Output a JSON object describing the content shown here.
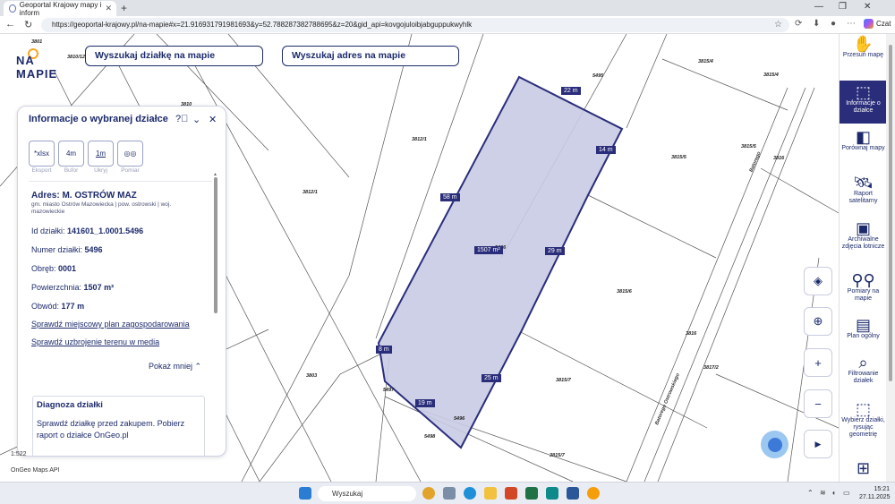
{
  "browser": {
    "tab_title": "Geoportal Krajowy mapy i inform",
    "url": "https://geoportal-krajowy.pl/na-mapie#x=21.916931791981693&y=52.788287382788695&z=20&gid_api=kovgojuloibjabguppukwyhlk",
    "copilot_label": "Czat"
  },
  "header": {
    "logo_text": "NA MAPIE",
    "search_parcel": "Wyszukaj działkę na mapie",
    "search_address": "Wyszukaj adres na mapie"
  },
  "panel": {
    "title": "Informacje o wybranej działce",
    "actions": [
      {
        "icon_text": "*xlsx",
        "label": "Eksport"
      },
      {
        "icon_text": "4m",
        "label": "Bufor"
      },
      {
        "icon_text": "1m",
        "label": "Ukryj"
      },
      {
        "icon_text": "◎◎",
        "label": "Pomiar"
      }
    ],
    "address": "Adres: M. OSTRÓW MAZ",
    "address_sub": "gm. miasto Ostrów Mazowiecka | pow. ostrowski | woj. mazowieckie",
    "rows": [
      {
        "label": "Id działki:",
        "value": "141601_1.0001.5496"
      },
      {
        "label": "Numer działki:",
        "value": "5496"
      },
      {
        "label": "Obręb:",
        "value": "0001"
      },
      {
        "label": "Powierzchnia:",
        "value": "1507 m²"
      },
      {
        "label": "Obwód:",
        "value": "177 m"
      }
    ],
    "link_plan": "Sprawdź miejscowy plan zagospodarowania",
    "link_media": "Sprawdź uzbrojenie terenu w media",
    "show_less": "Pokaż mniej",
    "diag_title": "Diagnoza działki",
    "diag_body": "Sprawdź działkę przed zakupem. Pobierz raport o działce OnGeo.pl"
  },
  "map": {
    "parcel_labels": [
      "3801",
      "3810/12",
      "3812/1",
      "3812/1",
      "5495",
      "3815/4",
      "3815/4",
      "3815/5",
      "3815/5",
      "3816",
      "3815/6",
      "3816",
      "3817/2",
      "3815/7",
      "3815/7",
      "3803",
      "5496",
      "5497",
      "5498",
      "5496",
      "3810"
    ],
    "streets": [
      "Batorego",
      "Batorego Ostrowskiego"
    ],
    "dimensions": [
      "22 m",
      "14 m",
      "58 m",
      "29 m",
      "1507 m²",
      "8 m",
      "19 m",
      "25 m"
    ],
    "scale": "1:522",
    "attribution": "OnGeo Maps API"
  },
  "sidebar": {
    "items": [
      {
        "label": "Przesuń mapę",
        "icon": "hand-icon"
      },
      {
        "label": "Informacje o działce",
        "icon": "select-icon"
      },
      {
        "label": "Porównaj mapy",
        "icon": "compare-icon"
      },
      {
        "label": "Raport satelitarny",
        "icon": "satellite-icon"
      },
      {
        "label": "Archiwalne zdjęcia lotnicze",
        "icon": "photo-icon"
      },
      {
        "label": "Pomiary na mapie",
        "icon": "measure-icon"
      },
      {
        "label": "Plan ogólny",
        "icon": "plan-icon"
      },
      {
        "label": "Filtrowanie działek",
        "icon": "filter-map-icon"
      },
      {
        "label": "Wybierz działki, rysując geometrię",
        "icon": "draw-icon"
      }
    ]
  },
  "taskbar": {
    "search_placeholder": "Wyszukaj",
    "time": "15:21",
    "date": "27.11.2025"
  },
  "colors": {
    "brand": "#1c2a6b",
    "active": "#2a2d7a",
    "parcel_fill": "#c9cbe6"
  }
}
